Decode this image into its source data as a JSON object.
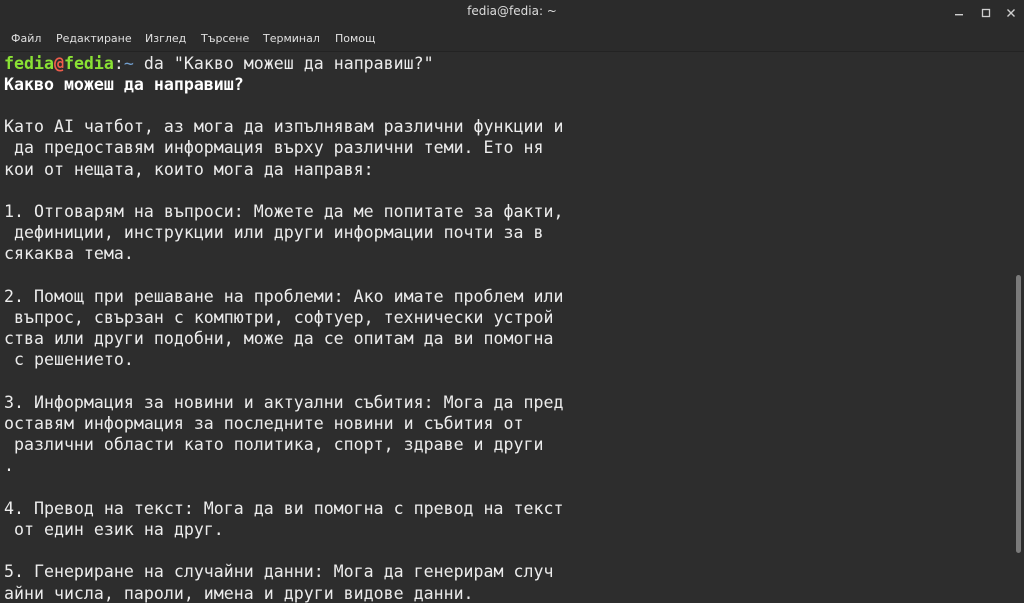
{
  "window": {
    "title": "fedia@fedia: ~"
  },
  "menu": [
    "Файл",
    "Редактиране",
    "Изглед",
    "Търсене",
    "Терминал",
    "Помощ"
  ],
  "prompt": {
    "user": "fedia",
    "at": "@",
    "host": "fedia",
    "colon": ":",
    "path": "~",
    "command": " da \"Какво можеш да направиш?\""
  },
  "output": {
    "echo_line": "Какво можеш да направиш?",
    "lines": [
      "",
      "Като AI чатбот, аз мога да изпълнявам различни функции и",
      " да предоставям информация върху различни теми. Ето ня",
      "кои от нещата, които мога да направя:",
      "",
      "1. Отговарям на въпроси: Можете да ме попитате за факти,",
      " дефиниции, инструкции или други информации почти за в",
      "сякаква тема.",
      "",
      "2. Помощ при решаване на проблеми: Ако имате проблем или",
      " въпрос, свързан с компютри, софтуер, технически устрой",
      "ства или други подобни, може да се опитам да ви помогна",
      " с решението.",
      "",
      "3. Информация за новини и актуални събития: Мога да пред",
      "оставям информация за последните новини и събития от",
      " различни области като политика, спорт, здраве и други",
      ".",
      "",
      "4. Превод на текст: Мога да ви помогна с превод на текст",
      " от един език на друг.",
      "",
      "5. Генериране на случайни данни: Мога да генерирам случ",
      "айни числа, пароли, имена и други видове данни."
    ]
  },
  "colors": {
    "background": "#2d2d2d",
    "prompt_user": "#8ae234",
    "prompt_at": "#ef5d4b",
    "prompt_path": "#729fcf",
    "text": "#ececec"
  },
  "icons": {
    "minimize": "minimize-icon",
    "maximize": "maximize-icon",
    "close": "close-icon"
  },
  "scroll": {
    "thumb_start_fraction": 0.405,
    "thumb_size_fraction": 0.505
  }
}
